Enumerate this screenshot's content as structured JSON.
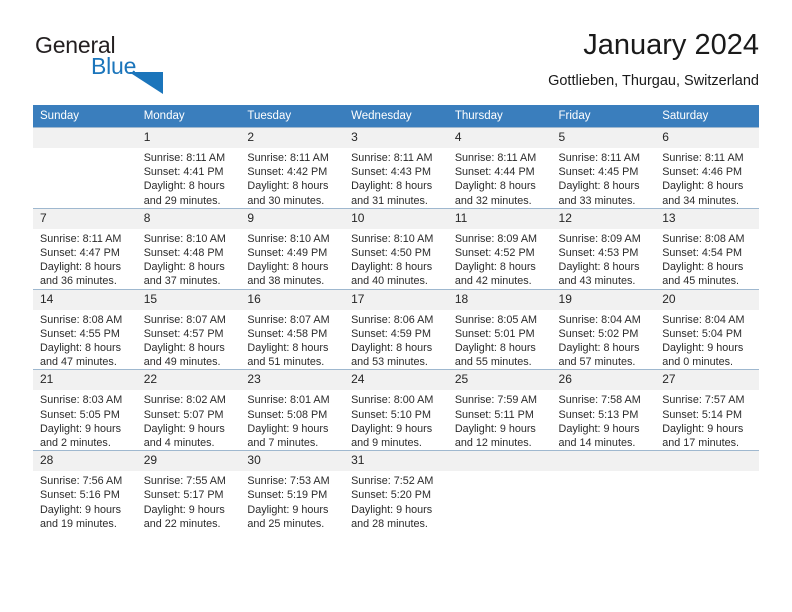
{
  "brand": {
    "word1": "General",
    "word2": "Blue",
    "triangle_color": "#1b75bb",
    "word1_color": "#231f20",
    "word2_color": "#1b75bb"
  },
  "header": {
    "title": "January 2024",
    "subtitle": "Gottlieben, Thurgau, Switzerland"
  },
  "calendar": {
    "header_bg": "#3a7ebd",
    "header_text_color": "#ffffff",
    "daynum_bg": "#f1f1f1",
    "border_color": "#9fb8cf",
    "weekdays": [
      "Sunday",
      "Monday",
      "Tuesday",
      "Wednesday",
      "Thursday",
      "Friday",
      "Saturday"
    ],
    "weeks": [
      [
        {
          "day": "",
          "blank": true,
          "sunrise": "",
          "sunset": "",
          "daylight1": "",
          "daylight2": ""
        },
        {
          "day": "1",
          "sunrise": "Sunrise: 8:11 AM",
          "sunset": "Sunset: 4:41 PM",
          "daylight1": "Daylight: 8 hours",
          "daylight2": "and 29 minutes."
        },
        {
          "day": "2",
          "sunrise": "Sunrise: 8:11 AM",
          "sunset": "Sunset: 4:42 PM",
          "daylight1": "Daylight: 8 hours",
          "daylight2": "and 30 minutes."
        },
        {
          "day": "3",
          "sunrise": "Sunrise: 8:11 AM",
          "sunset": "Sunset: 4:43 PM",
          "daylight1": "Daylight: 8 hours",
          "daylight2": "and 31 minutes."
        },
        {
          "day": "4",
          "sunrise": "Sunrise: 8:11 AM",
          "sunset": "Sunset: 4:44 PM",
          "daylight1": "Daylight: 8 hours",
          "daylight2": "and 32 minutes."
        },
        {
          "day": "5",
          "sunrise": "Sunrise: 8:11 AM",
          "sunset": "Sunset: 4:45 PM",
          "daylight1": "Daylight: 8 hours",
          "daylight2": "and 33 minutes."
        },
        {
          "day": "6",
          "sunrise": "Sunrise: 8:11 AM",
          "sunset": "Sunset: 4:46 PM",
          "daylight1": "Daylight: 8 hours",
          "daylight2": "and 34 minutes."
        }
      ],
      [
        {
          "day": "7",
          "sunrise": "Sunrise: 8:11 AM",
          "sunset": "Sunset: 4:47 PM",
          "daylight1": "Daylight: 8 hours",
          "daylight2": "and 36 minutes."
        },
        {
          "day": "8",
          "sunrise": "Sunrise: 8:10 AM",
          "sunset": "Sunset: 4:48 PM",
          "daylight1": "Daylight: 8 hours",
          "daylight2": "and 37 minutes."
        },
        {
          "day": "9",
          "sunrise": "Sunrise: 8:10 AM",
          "sunset": "Sunset: 4:49 PM",
          "daylight1": "Daylight: 8 hours",
          "daylight2": "and 38 minutes."
        },
        {
          "day": "10",
          "sunrise": "Sunrise: 8:10 AM",
          "sunset": "Sunset: 4:50 PM",
          "daylight1": "Daylight: 8 hours",
          "daylight2": "and 40 minutes."
        },
        {
          "day": "11",
          "sunrise": "Sunrise: 8:09 AM",
          "sunset": "Sunset: 4:52 PM",
          "daylight1": "Daylight: 8 hours",
          "daylight2": "and 42 minutes."
        },
        {
          "day": "12",
          "sunrise": "Sunrise: 8:09 AM",
          "sunset": "Sunset: 4:53 PM",
          "daylight1": "Daylight: 8 hours",
          "daylight2": "and 43 minutes."
        },
        {
          "day": "13",
          "sunrise": "Sunrise: 8:08 AM",
          "sunset": "Sunset: 4:54 PM",
          "daylight1": "Daylight: 8 hours",
          "daylight2": "and 45 minutes."
        }
      ],
      [
        {
          "day": "14",
          "sunrise": "Sunrise: 8:08 AM",
          "sunset": "Sunset: 4:55 PM",
          "daylight1": "Daylight: 8 hours",
          "daylight2": "and 47 minutes."
        },
        {
          "day": "15",
          "sunrise": "Sunrise: 8:07 AM",
          "sunset": "Sunset: 4:57 PM",
          "daylight1": "Daylight: 8 hours",
          "daylight2": "and 49 minutes."
        },
        {
          "day": "16",
          "sunrise": "Sunrise: 8:07 AM",
          "sunset": "Sunset: 4:58 PM",
          "daylight1": "Daylight: 8 hours",
          "daylight2": "and 51 minutes."
        },
        {
          "day": "17",
          "sunrise": "Sunrise: 8:06 AM",
          "sunset": "Sunset: 4:59 PM",
          "daylight1": "Daylight: 8 hours",
          "daylight2": "and 53 minutes."
        },
        {
          "day": "18",
          "sunrise": "Sunrise: 8:05 AM",
          "sunset": "Sunset: 5:01 PM",
          "daylight1": "Daylight: 8 hours",
          "daylight2": "and 55 minutes."
        },
        {
          "day": "19",
          "sunrise": "Sunrise: 8:04 AM",
          "sunset": "Sunset: 5:02 PM",
          "daylight1": "Daylight: 8 hours",
          "daylight2": "and 57 minutes."
        },
        {
          "day": "20",
          "sunrise": "Sunrise: 8:04 AM",
          "sunset": "Sunset: 5:04 PM",
          "daylight1": "Daylight: 9 hours",
          "daylight2": "and 0 minutes."
        }
      ],
      [
        {
          "day": "21",
          "sunrise": "Sunrise: 8:03 AM",
          "sunset": "Sunset: 5:05 PM",
          "daylight1": "Daylight: 9 hours",
          "daylight2": "and 2 minutes."
        },
        {
          "day": "22",
          "sunrise": "Sunrise: 8:02 AM",
          "sunset": "Sunset: 5:07 PM",
          "daylight1": "Daylight: 9 hours",
          "daylight2": "and 4 minutes."
        },
        {
          "day": "23",
          "sunrise": "Sunrise: 8:01 AM",
          "sunset": "Sunset: 5:08 PM",
          "daylight1": "Daylight: 9 hours",
          "daylight2": "and 7 minutes."
        },
        {
          "day": "24",
          "sunrise": "Sunrise: 8:00 AM",
          "sunset": "Sunset: 5:10 PM",
          "daylight1": "Daylight: 9 hours",
          "daylight2": "and 9 minutes."
        },
        {
          "day": "25",
          "sunrise": "Sunrise: 7:59 AM",
          "sunset": "Sunset: 5:11 PM",
          "daylight1": "Daylight: 9 hours",
          "daylight2": "and 12 minutes."
        },
        {
          "day": "26",
          "sunrise": "Sunrise: 7:58 AM",
          "sunset": "Sunset: 5:13 PM",
          "daylight1": "Daylight: 9 hours",
          "daylight2": "and 14 minutes."
        },
        {
          "day": "27",
          "sunrise": "Sunrise: 7:57 AM",
          "sunset": "Sunset: 5:14 PM",
          "daylight1": "Daylight: 9 hours",
          "daylight2": "and 17 minutes."
        }
      ],
      [
        {
          "day": "28",
          "sunrise": "Sunrise: 7:56 AM",
          "sunset": "Sunset: 5:16 PM",
          "daylight1": "Daylight: 9 hours",
          "daylight2": "and 19 minutes."
        },
        {
          "day": "29",
          "sunrise": "Sunrise: 7:55 AM",
          "sunset": "Sunset: 5:17 PM",
          "daylight1": "Daylight: 9 hours",
          "daylight2": "and 22 minutes."
        },
        {
          "day": "30",
          "sunrise": "Sunrise: 7:53 AM",
          "sunset": "Sunset: 5:19 PM",
          "daylight1": "Daylight: 9 hours",
          "daylight2": "and 25 minutes."
        },
        {
          "day": "31",
          "sunrise": "Sunrise: 7:52 AM",
          "sunset": "Sunset: 5:20 PM",
          "daylight1": "Daylight: 9 hours",
          "daylight2": "and 28 minutes."
        },
        {
          "day": "",
          "blank": true,
          "sunrise": "",
          "sunset": "",
          "daylight1": "",
          "daylight2": ""
        },
        {
          "day": "",
          "blank": true,
          "sunrise": "",
          "sunset": "",
          "daylight1": "",
          "daylight2": ""
        },
        {
          "day": "",
          "blank": true,
          "sunrise": "",
          "sunset": "",
          "daylight1": "",
          "daylight2": ""
        }
      ]
    ]
  }
}
